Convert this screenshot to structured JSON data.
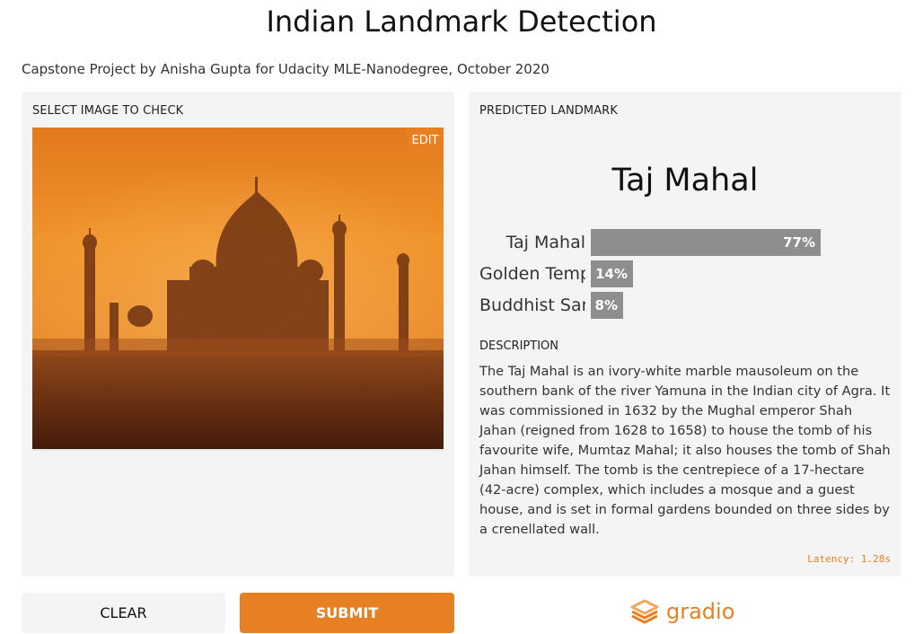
{
  "header": {
    "title": "Indian Landmark Detection",
    "subtitle": "Capstone Project by Anisha Gupta for Udacity MLE-Nanodegree, October 2020"
  },
  "input_panel": {
    "label": "SELECT IMAGE TO CHECK",
    "edit_label": "EDIT",
    "image_icon": "taj-mahal-sunset-photo"
  },
  "output_panel": {
    "label": "PREDICTED LANDMARK",
    "predicted": "Taj Mahal",
    "confidences": [
      {
        "name": "Taj Mahal",
        "percent": "77%",
        "value": 0.77
      },
      {
        "name": "Golden Temple",
        "percent": "14%",
        "value": 0.14
      },
      {
        "name": "Buddhist Sarnath",
        "percent": "8%",
        "value": 0.08
      }
    ],
    "description_label": "DESCRIPTION",
    "description": "The Taj Mahal is an ivory-white marble mausoleum on the southern bank of the river Yamuna in the Indian city of Agra. It was commissioned in 1632 by the Mughal emperor Shah Jahan (reigned from 1628 to 1658) to house the tomb of his favourite wife, Mumtaz Mahal; it also houses the tomb of Shah Jahan himself. The tomb is the centrepiece of a 17-hectare (42-acre) complex, which includes a mosque and a guest house, and is set in formal gardens bounded on three sides by a crenellated wall.",
    "latency": "Latency: 1.28s"
  },
  "actions": {
    "clear_label": "CLEAR",
    "submit_label": "SUBMIT"
  },
  "footer": {
    "brand": "gradio",
    "brand_icon": "gradio-logo-icon"
  },
  "colors": {
    "accent": "#e97f23",
    "panel_bg": "#f4f4f4",
    "bar": "#8e8e8e"
  }
}
